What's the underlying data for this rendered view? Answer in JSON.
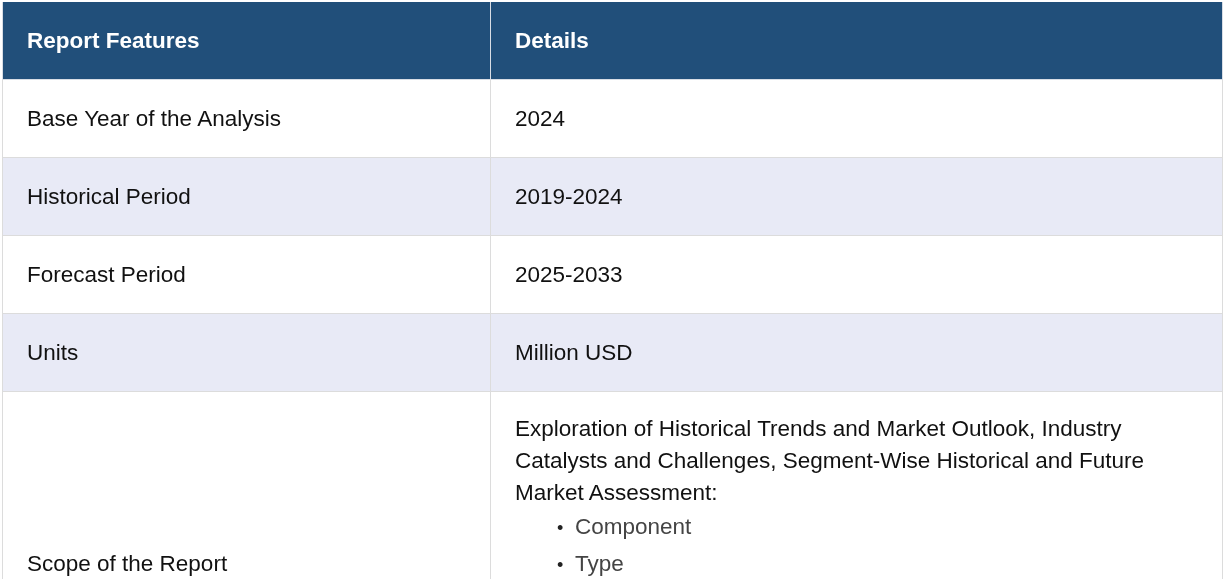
{
  "table": {
    "columns": [
      "Report Features",
      "Details"
    ],
    "rows": [
      {
        "feature": "Base Year of the Analysis",
        "details": "2024"
      },
      {
        "feature": "Historical Period",
        "details": "2019-2024"
      },
      {
        "feature": "Forecast Period",
        "details": "2025-2033"
      },
      {
        "feature": "Units",
        "details": "Million USD"
      },
      {
        "feature": "Scope of the Report",
        "details": "Exploration of Historical Trends and Market Outlook, Industry Catalysts and Challenges, Segment-Wise Historical and Future Market Assessment:",
        "list": [
          {
            "marker": "•",
            "text": "Component"
          },
          {
            "marker": "•",
            "text": "Type"
          }
        ]
      }
    ]
  }
}
